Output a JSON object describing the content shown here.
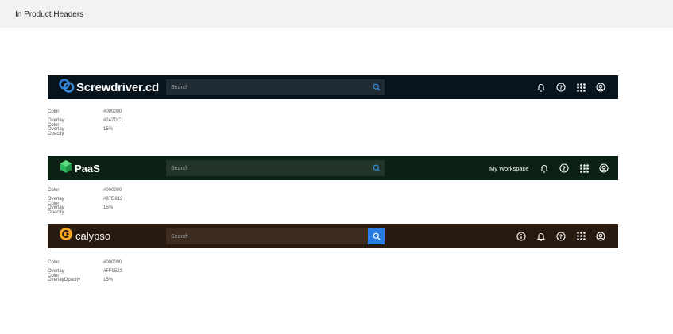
{
  "page": {
    "title": "In Product Headers"
  },
  "headers": [
    {
      "brand": "Screwdriver.cd",
      "search_placeholder": "Search",
      "props": [
        {
          "k": "Color",
          "v": "#000000"
        },
        {
          "k": "Overlay Color",
          "v": "#247DC1"
        },
        {
          "k": "Overlay Opacity",
          "v": "15%"
        }
      ]
    },
    {
      "brand": "PaaS",
      "search_placeholder": "Search",
      "workspace_label": "My Workspace",
      "props": [
        {
          "k": "Color",
          "v": "#000000"
        },
        {
          "k": "Overlay Color",
          "v": "#87D812"
        },
        {
          "k": "Overlay Opacity",
          "v": "15%"
        }
      ]
    },
    {
      "brand": "calypso",
      "search_placeholder": "Search",
      "props": [
        {
          "k": "Color",
          "v": "#000000"
        },
        {
          "k": "Overlay Color",
          "v": "#FF9523"
        },
        {
          "k": "OverlayOpacity",
          "v": "15%"
        }
      ]
    }
  ],
  "colors": {
    "screwdriver_bar": "#08141d",
    "paas_bar": "#0a2114",
    "calypso_bar": "#281a0f",
    "search_button_blue": "#2a7de1",
    "search_icon_blue": "#3b8fe0"
  },
  "icons": [
    "bell-icon",
    "help-icon",
    "apps-grid-icon",
    "user-profile-icon",
    "info-icon",
    "search-icon"
  ]
}
